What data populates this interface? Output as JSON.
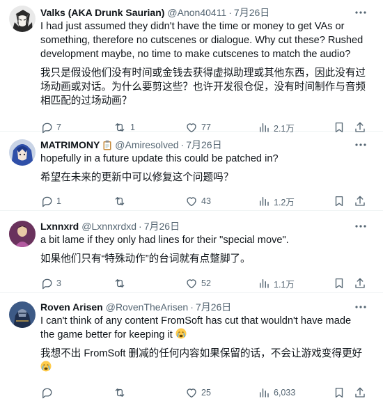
{
  "posts": [
    {
      "name": "Valks (AKA Drunk Saurian)",
      "handle": "@Anon40411",
      "separator": "·",
      "date": "7月26日",
      "text": "I had just assumed they didn't have the time or money to get VAs or something, therefore no cutscenes or dialogue. Why cut these? Rushed development maybe, no time to make cutscenes to match the audio?",
      "translation": "我只是假设他们没有时间或金钱去获得虚拟助理或其他东西，因此没有过场动画或对话。为什么要剪这些？也许开发很仓促，没有时间制作与音频相匹配的过场动画？",
      "replies": "7",
      "reposts": "1",
      "likes": "77",
      "views": "2.1万",
      "avatar": "anime-avatar-dark-hair"
    },
    {
      "name": "MATRIMONY",
      "handle": "@Amiresolved",
      "separator": "·",
      "date": "7月26日",
      "text": "hopefully in a future update this could be patched in?",
      "translation": "希望在未来的更新中可以修复这个问题吗？",
      "replies": "1",
      "reposts": "",
      "likes": "43",
      "views": "1.2万",
      "avatar": "anime-avatar-blue-hair",
      "badge": "clipboard-emoji"
    },
    {
      "name": "Lxnnxrd",
      "handle": "@Lxnnxrdxd",
      "separator": "·",
      "date": "7月26日",
      "text": "a bit lame if they only had lines for their \"special move\".",
      "translation": "如果他们只有“特殊动作”的台词就有点蹩脚了。",
      "replies": "3",
      "reposts": "",
      "likes": "52",
      "views": "1.1万",
      "avatar": "purple-figure-avatar"
    },
    {
      "name": "Roven Arisen",
      "handle": "@RovenTheArisen",
      "separator": "·",
      "date": "7月26日",
      "text": "I can't think of any content FromSoft has cut that wouldn't have made the game better for keeping it",
      "translation": "我想不出 FromSoft 删减的任何内容如果保留的话，不会让游戏变得更好",
      "replies": "",
      "reposts": "",
      "likes": "25",
      "views": "6,033",
      "avatar": "armored-knight-avatar",
      "emoji": "crying-face-emoji"
    }
  ],
  "colors": {
    "text": "#0f1419",
    "muted": "#536471",
    "border": "#eff3f4"
  }
}
